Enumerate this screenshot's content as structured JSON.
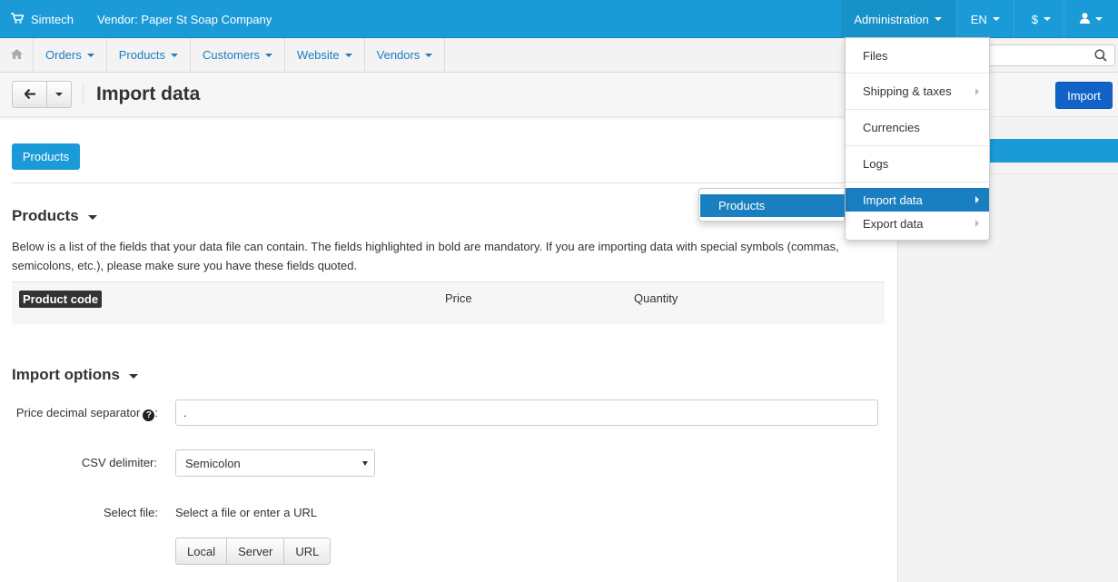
{
  "topbar": {
    "store_name": "Simtech",
    "vendor": "Vendor: Paper St Soap Company",
    "administration": "Administration",
    "language": "EN",
    "currency": "$"
  },
  "nav": {
    "items": [
      "Orders",
      "Products",
      "Customers",
      "Website",
      "Vendors"
    ],
    "search_value": ""
  },
  "title_bar": {
    "title": "Import data",
    "import_button": "Import"
  },
  "tabs": [
    "Products"
  ],
  "products_section": {
    "title": "Products",
    "description": "Below is a list of the fields that your data file can contain. The fields highlighted in bold are mandatory. If you are importing data with special symbols (commas, semicolons, etc.), please make sure you have these fields quoted.",
    "fields": [
      "Product code",
      "Price",
      "Quantity"
    ]
  },
  "import_options": {
    "title": "Import options",
    "price_separator_label": "Price decimal separator",
    "price_separator_value": ".",
    "csv_delimiter_label": "CSV delimiter:",
    "csv_delimiter_value": "Semicolon",
    "select_file_label": "Select file:",
    "select_file_hint": "Select a file or enter a URL",
    "file_sources": [
      "Local",
      "Server",
      "URL"
    ]
  },
  "admin_menu": {
    "items": [
      "Files",
      "Shipping & taxes",
      "Currencies",
      "Logs",
      "Import data",
      "Export data"
    ],
    "active": "Import data",
    "submenu": [
      "Products"
    ]
  },
  "colors": {
    "topbar": "#1a9bd7",
    "primary_button": "#1163c8",
    "menu_active": "#1a7fc1"
  }
}
